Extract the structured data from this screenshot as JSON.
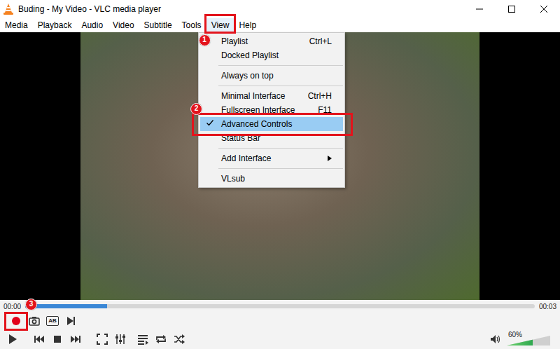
{
  "window": {
    "title": "Buding - My Video - VLC media player",
    "controls": [
      {
        "kind": "minimize"
      },
      {
        "kind": "maximize"
      },
      {
        "kind": "close"
      }
    ]
  },
  "menu_bar": [
    {
      "label": "Media",
      "selected": false
    },
    {
      "label": "Playback",
      "selected": false
    },
    {
      "label": "Audio",
      "selected": false
    },
    {
      "label": "Video",
      "selected": false
    },
    {
      "label": "Subtitle",
      "selected": false
    },
    {
      "label": "Tools",
      "selected": false
    },
    {
      "label": "View",
      "selected": true,
      "annotation": "1"
    },
    {
      "label": "Help",
      "selected": false
    }
  ],
  "view_menu": {
    "items": [
      {
        "kind": "item",
        "label": "Playlist",
        "shortcut": "Ctrl+L",
        "checked": false,
        "selected": false,
        "submenu": false
      },
      {
        "kind": "item",
        "label": "Docked Playlist",
        "shortcut": "",
        "checked": false,
        "selected": false,
        "submenu": false
      },
      {
        "kind": "separator"
      },
      {
        "kind": "item",
        "label": "Always on top",
        "shortcut": "",
        "checked": false,
        "selected": false,
        "submenu": false
      },
      {
        "kind": "separator"
      },
      {
        "kind": "item",
        "label": "Minimal Interface",
        "shortcut": "Ctrl+H",
        "checked": false,
        "selected": false,
        "submenu": false
      },
      {
        "kind": "item",
        "label": "Fullscreen Interface",
        "shortcut": "F11",
        "checked": false,
        "selected": false,
        "submenu": false
      },
      {
        "kind": "item",
        "label": "Advanced Controls",
        "shortcut": "",
        "checked": true,
        "selected": true,
        "submenu": false,
        "annotation": "2"
      },
      {
        "kind": "item",
        "label": "Status Bar",
        "shortcut": "",
        "checked": false,
        "selected": false,
        "submenu": false
      },
      {
        "kind": "separator"
      },
      {
        "kind": "item",
        "label": "Add Interface",
        "shortcut": "",
        "checked": false,
        "selected": false,
        "submenu": true
      },
      {
        "kind": "separator"
      },
      {
        "kind": "item",
        "label": "VLsub",
        "shortcut": "",
        "checked": false,
        "selected": false,
        "submenu": false
      }
    ]
  },
  "seek": {
    "elapsed": "00:00",
    "total": "00:03",
    "level": 0.16
  },
  "advanced_controls": [
    {
      "kind": "record",
      "annotation": "3"
    },
    {
      "kind": "snapshot"
    },
    {
      "kind": "ab-loop",
      "label": "AB"
    },
    {
      "kind": "frame-step"
    }
  ],
  "controls": [
    {
      "kind": "play"
    },
    {
      "kind": "previous"
    },
    {
      "kind": "stop"
    },
    {
      "kind": "next"
    },
    {
      "kind": "fullscreen"
    },
    {
      "kind": "extended"
    },
    {
      "kind": "playlist"
    },
    {
      "kind": "loop"
    },
    {
      "kind": "shuffle"
    }
  ],
  "volume": {
    "muted": false,
    "level": 0.6,
    "reading": "60%"
  }
}
